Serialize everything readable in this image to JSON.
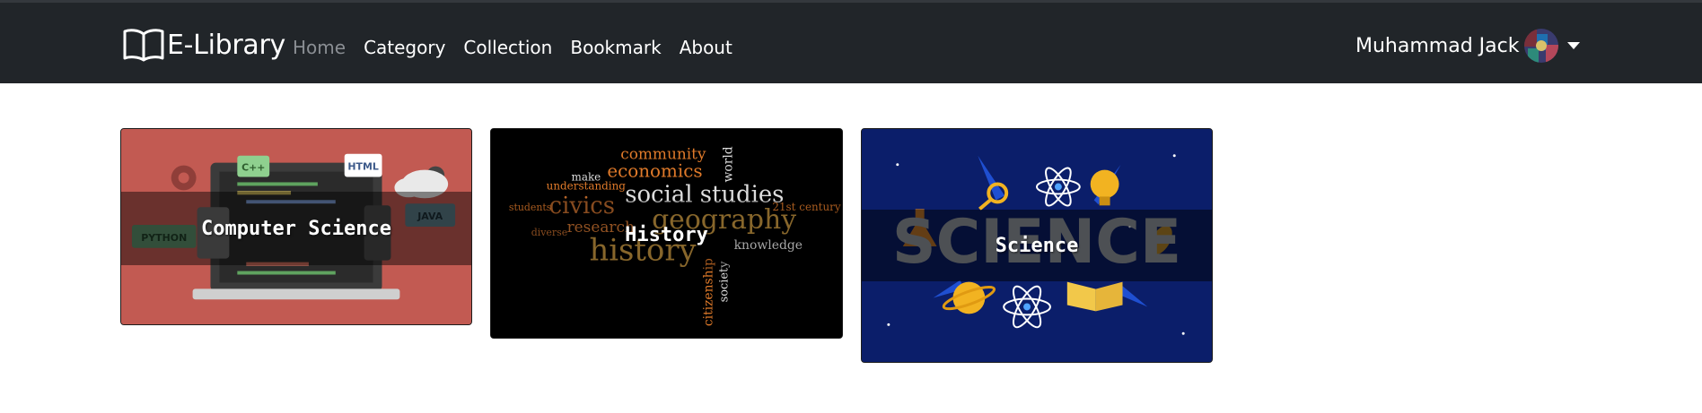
{
  "navbar": {
    "brand": "E-Library",
    "links": [
      "Home",
      "Category",
      "Collection",
      "Bookmark",
      "About"
    ],
    "active_link": "Home",
    "user_name": "Muhammad Jack"
  },
  "cards": [
    {
      "title": "Computer Science",
      "image_words": [
        "C++",
        "HTML",
        "PYTHON",
        "JAVA"
      ]
    },
    {
      "title": "History",
      "image_words": [
        "community",
        "economics",
        "social studies",
        "civics",
        "geography",
        "history",
        "research",
        "citizenship",
        "understanding",
        "21st century",
        "knowledge",
        "world",
        "society",
        "make",
        "students",
        "diverse"
      ]
    },
    {
      "title": "Science",
      "image_words": [
        "SCIENCE"
      ]
    }
  ],
  "colors": {
    "navbar_bg": "#212529",
    "nav_active": "#8a8e93",
    "cs_bg": "#c25a52",
    "history_bg": "#000000",
    "science_bg": "#0b1e6a"
  }
}
